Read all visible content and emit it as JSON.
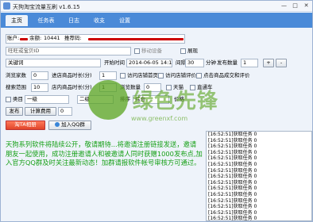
{
  "window": {
    "title": "天狗淘宝流量互刷 v1.6.15",
    "minimize": "—",
    "maximize": "□",
    "close": "✕"
  },
  "tabs": [
    "主页",
    "任务表",
    "日志",
    "收支",
    "设置"
  ],
  "account": {
    "label": "账户:",
    "balance_label": "余额:",
    "balance": "10441",
    "referrer_label": "推荐码:"
  },
  "form": {
    "wangwang_placeholder": "旺旺或宝贝ID",
    "mobile_device": "移动设备",
    "expand": "展现",
    "keyword_label": "关键词",
    "start_time_label": "开始时间",
    "start_time": "2014-06-05 14:14",
    "interval_label": "间隔",
    "interval_value": "30",
    "minutes_label": "分钟",
    "publish_count_label": "发布数量",
    "publish_count": "1",
    "plus": "+",
    "minus": "-",
    "browse_count_label": "浏览家数",
    "browse_count": "0",
    "in_shop_time_label": "进店商品时长(分)",
    "in_shop_time": "1",
    "visit_coll_label": "访问店铺首页",
    "visit_review_label": "访问店铺评价",
    "click_review_label": "点击商品成交和评价",
    "search_page_label": "搜索范围",
    "search_page": "10",
    "store_time_label": "店内商品时长(分)",
    "store_time": "1",
    "browse_num_label": "浏览数量",
    "browse_num": "0",
    "tmall_label": "天猫",
    "direct_label": "直通车",
    "category_label": "类目",
    "level1": "一级",
    "level2": "二级",
    "sort_label": "排序",
    "sort_value": "综合",
    "price_label": "价格",
    "publish_btn": "发布",
    "calc_fee_btn": "计算费用",
    "fee_value": "0"
  },
  "mid_buttons": {
    "search_btn": "淘TA相册",
    "qq_btn": "加入QQ群"
  },
  "notice": "天狗系列软件将陆续公开，敬请期待...将邀请注册链接发送，邀请朋友一起使用，成功注册邀请人和被邀请人同时获赠1000发布点,加入官方QQ群及时关注最新动态！加群请报软件帐号审核方可通过。",
  "log": [
    "[16:52:51]获取任务 0",
    "[16:52:51]获取任务 0",
    "[16:52:51]获取任务 0",
    "[16:52:51]获取任务 0",
    "[16:52:51]获取任务 0",
    "[16:52:51]获取任务 0",
    "[16:52:51]获取任务 0",
    "[16:52:51]获取任务 0",
    "[16:52:51]获取任务 0",
    "[16:52:51]获取任务 0",
    "[16:52:51]获取任务 0",
    "[16:52:51]获取任务 0",
    "[16:52:51]获取任务 0",
    "[16:52:51]获取任务 0",
    "[16:52:51]获取任务 0"
  ],
  "watermark": {
    "brand": "绿色先锋",
    "url": "www.greenxf.com"
  },
  "colors": {
    "tabbar": "#4a8ad8",
    "notice": "#17a017",
    "redact": "#cc0000",
    "watermark": "#5aa41e"
  }
}
